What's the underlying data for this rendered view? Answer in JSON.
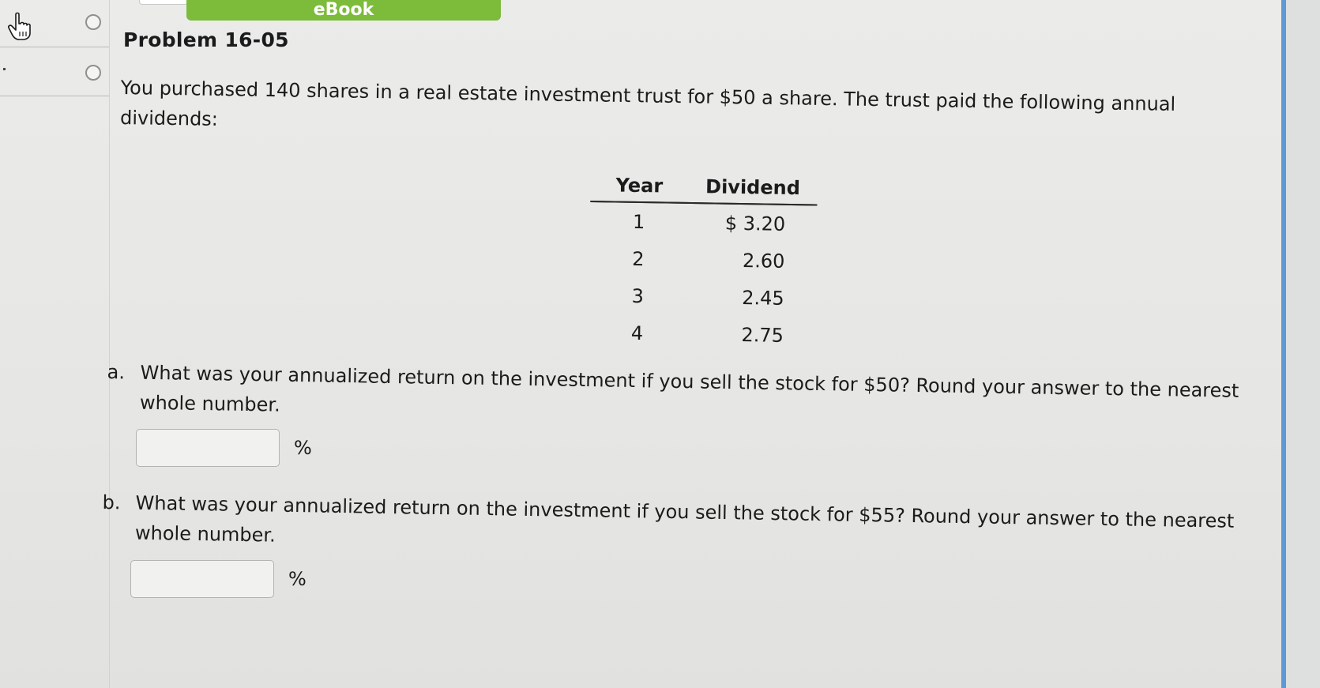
{
  "toolbar": {
    "ebook_label": "eBook"
  },
  "problem": {
    "title": "Problem 16-05",
    "text": "You purchased 140 shares in a real estate investment trust for $50 a share. The trust paid the following annual dividends:"
  },
  "table": {
    "headers": [
      "Year",
      "Dividend"
    ],
    "rows": [
      {
        "year": "1",
        "dividend": "$ 3.20"
      },
      {
        "year": "2",
        "dividend": "2.60"
      },
      {
        "year": "3",
        "dividend": "2.45"
      },
      {
        "year": "4",
        "dividend": "2.75"
      }
    ]
  },
  "questions": [
    {
      "letter": "a.",
      "text": "What was your annualized return on the investment if you sell the stock for $50? Round your answer to the nearest",
      "text_line2": "whole number.",
      "input_value": "",
      "unit": "%"
    },
    {
      "letter": "b.",
      "text": "What was your annualized return on the investment if you sell the stock for $55? Round your answer to the nearest",
      "text_line2": "whole number.",
      "input_value": "",
      "unit": "%"
    }
  ],
  "colors": {
    "ebook_green": "#7dbb3a",
    "scrollbar_blue": "#5b9ad6",
    "background": "#e9e9e7"
  },
  "icons": {
    "cursor": "pointer-hand-icon"
  }
}
